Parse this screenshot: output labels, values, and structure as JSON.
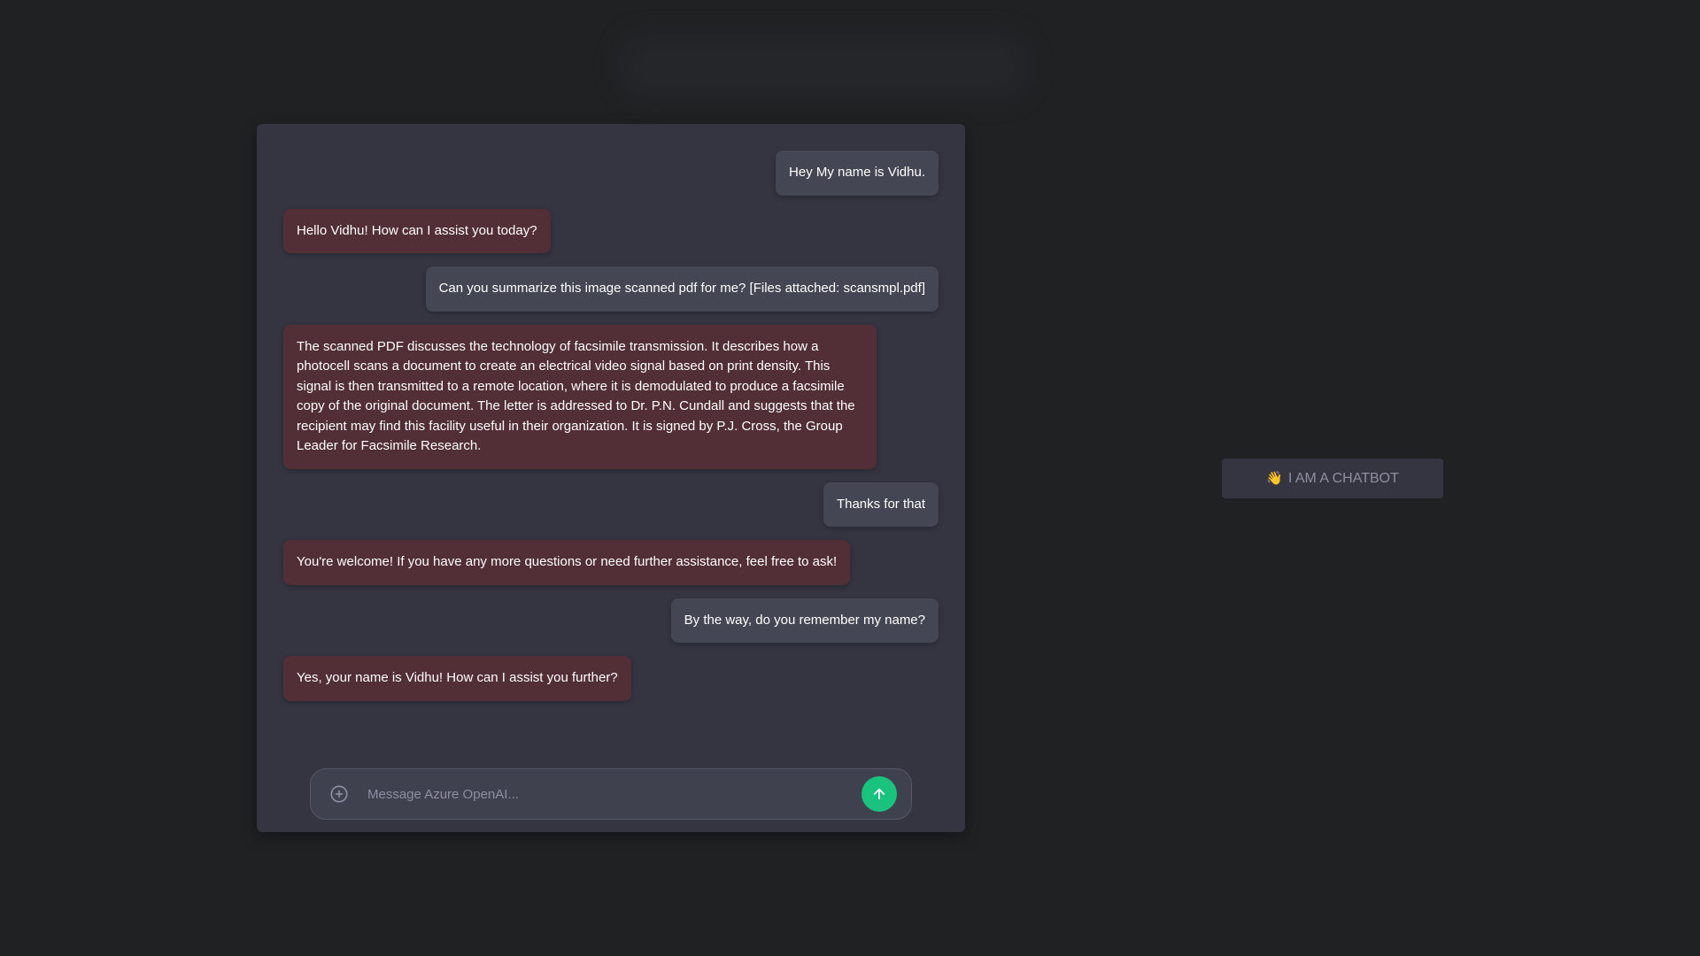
{
  "messages": [
    {
      "role": "user",
      "text": "Hey My name is Vidhu."
    },
    {
      "role": "bot",
      "text": "Hello Vidhu! How can I assist you today?"
    },
    {
      "role": "user",
      "text": "Can you summarize this image scanned pdf for me? [Files attached: scansmpl.pdf]"
    },
    {
      "role": "bot",
      "text": "The scanned PDF discusses the technology of facsimile transmission. It describes how a photocell scans a document to create an electrical video signal based on print density. This signal is then transmitted to a remote location, where it is demodulated to produce a facsimile copy of the original document. The letter is addressed to Dr. P.N. Cundall and suggests that the recipient may find this facility useful in their organization. It is signed by P.J. Cross, the Group Leader for Facsimile Research."
    },
    {
      "role": "user",
      "text": "Thanks for that"
    },
    {
      "role": "bot",
      "text": "You're welcome! If you have any more questions or need further assistance, feel free to ask!"
    },
    {
      "role": "user",
      "text": "By the way, do you remember my name?"
    },
    {
      "role": "bot",
      "text": "Yes, your name is Vidhu! How can I assist you further?"
    }
  ],
  "composer": {
    "placeholder": "Message Azure OpenAI...",
    "value": "",
    "attach_icon": "plus-circle-icon",
    "send_icon": "arrow-up-icon"
  },
  "badge": {
    "icon": "waving-hand-icon",
    "emoji": "👋",
    "label": "I AM A CHATBOT"
  },
  "colors": {
    "background": "#202123",
    "panel": "#343541",
    "user_bubble": "#444654",
    "bot_bubble": "#522e36",
    "send_button": "#19c37d"
  }
}
